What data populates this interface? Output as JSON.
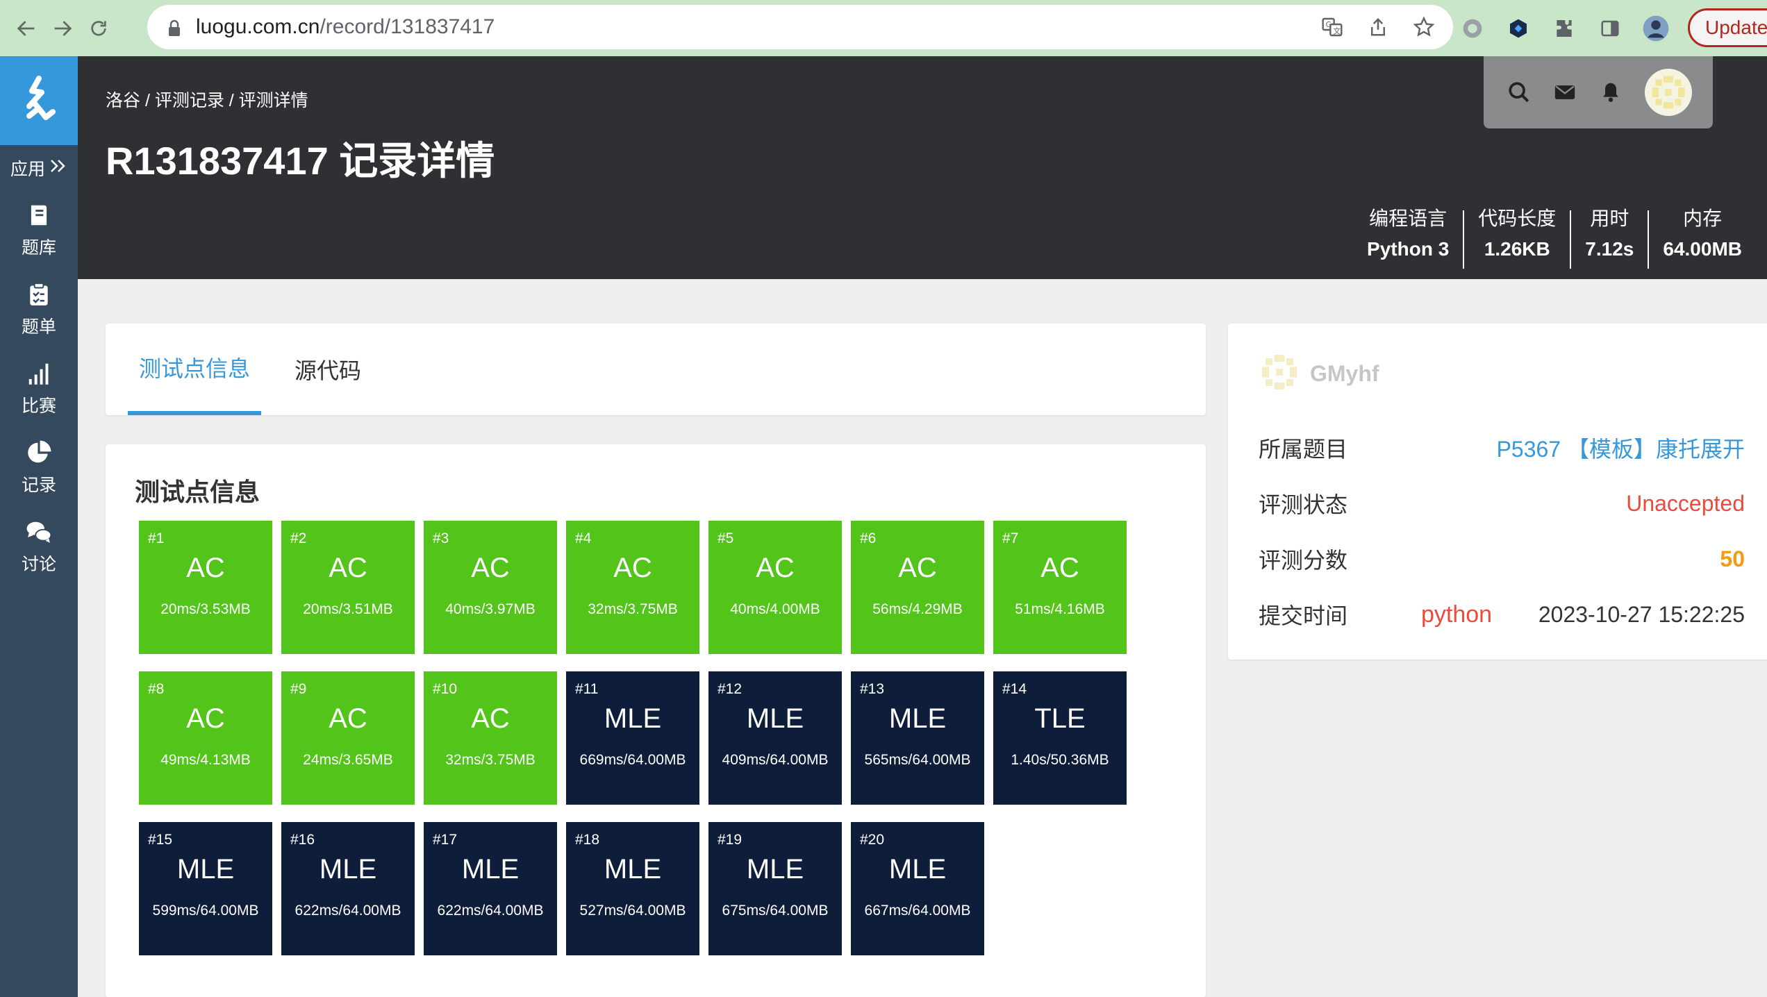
{
  "browser": {
    "url_host": "luogu.com.cn",
    "url_path": "/record/131837417",
    "update_label": "Update"
  },
  "sidebar": {
    "apps_label": "应用",
    "items": [
      {
        "label": "题库",
        "icon": "book-icon"
      },
      {
        "label": "题单",
        "icon": "clipboard-icon"
      },
      {
        "label": "比赛",
        "icon": "signal-bars-icon"
      },
      {
        "label": "记录",
        "icon": "pie-chart-icon"
      },
      {
        "label": "讨论",
        "icon": "chat-icon"
      }
    ]
  },
  "header": {
    "breadcrumb": "洛谷 / 评测记录 / 评测详情",
    "title": "R131837417 记录详情",
    "stats": [
      {
        "label": "编程语言",
        "value": "Python 3"
      },
      {
        "label": "代码长度",
        "value": "1.26KB"
      },
      {
        "label": "用时",
        "value": "7.12s"
      },
      {
        "label": "内存",
        "value": "64.00MB"
      }
    ]
  },
  "tabs": {
    "active": "测试点信息",
    "other": "源代码"
  },
  "testcases": {
    "title": "测试点信息",
    "items": [
      {
        "num": "#1",
        "status": "AC",
        "detail": "20ms/3.53MB"
      },
      {
        "num": "#2",
        "status": "AC",
        "detail": "20ms/3.51MB"
      },
      {
        "num": "#3",
        "status": "AC",
        "detail": "40ms/3.97MB"
      },
      {
        "num": "#4",
        "status": "AC",
        "detail": "32ms/3.75MB"
      },
      {
        "num": "#5",
        "status": "AC",
        "detail": "40ms/4.00MB"
      },
      {
        "num": "#6",
        "status": "AC",
        "detail": "56ms/4.29MB"
      },
      {
        "num": "#7",
        "status": "AC",
        "detail": "51ms/4.16MB"
      },
      {
        "num": "#8",
        "status": "AC",
        "detail": "49ms/4.13MB"
      },
      {
        "num": "#9",
        "status": "AC",
        "detail": "24ms/3.65MB"
      },
      {
        "num": "#10",
        "status": "AC",
        "detail": "32ms/3.75MB"
      },
      {
        "num": "#11",
        "status": "MLE",
        "detail": "669ms/64.00MB"
      },
      {
        "num": "#12",
        "status": "MLE",
        "detail": "409ms/64.00MB"
      },
      {
        "num": "#13",
        "status": "MLE",
        "detail": "565ms/64.00MB"
      },
      {
        "num": "#14",
        "status": "TLE",
        "detail": "1.40s/50.36MB"
      },
      {
        "num": "#15",
        "status": "MLE",
        "detail": "599ms/64.00MB"
      },
      {
        "num": "#16",
        "status": "MLE",
        "detail": "622ms/64.00MB"
      },
      {
        "num": "#17",
        "status": "MLE",
        "detail": "622ms/64.00MB"
      },
      {
        "num": "#18",
        "status": "MLE",
        "detail": "527ms/64.00MB"
      },
      {
        "num": "#19",
        "status": "MLE",
        "detail": "675ms/64.00MB"
      },
      {
        "num": "#20",
        "status": "MLE",
        "detail": "667ms/64.00MB"
      }
    ]
  },
  "info": {
    "user": "GMyhf",
    "problem_label": "所属题目",
    "problem_value": "P5367 【模板】康托展开",
    "status_label": "评测状态",
    "status_value": "Unaccepted",
    "score_label": "评测分数",
    "score_value": "50",
    "time_label": "提交时间",
    "time_value": "2023-10-27 15:22:25",
    "language_tag": "python"
  },
  "colors": {
    "ac": "#52c41a",
    "mle": "#0e1d3a",
    "accent": "#3498db",
    "sidebar": "#34495e",
    "header": "#2f3033",
    "unaccepted": "#e74c3c",
    "score": "#f39c12"
  }
}
